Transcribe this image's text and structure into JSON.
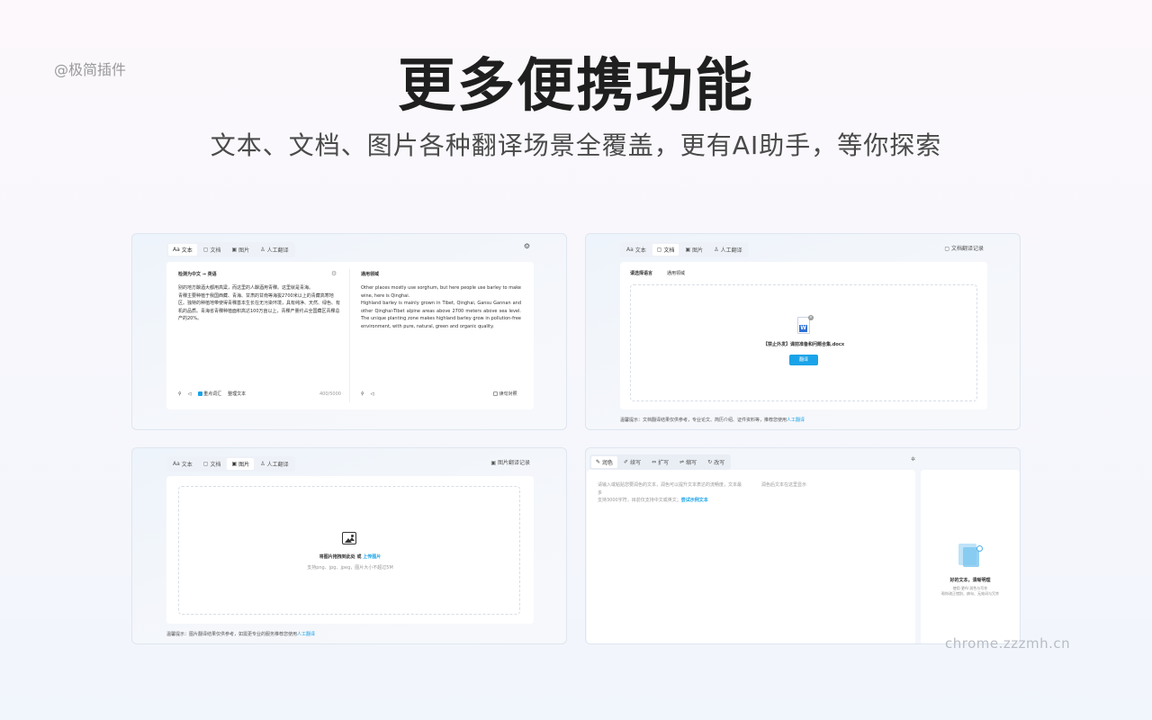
{
  "brand": "@极简插件",
  "hero": {
    "title": "更多便携功能",
    "subtitle": "文本、文档、图片各种翻译场景全覆盖，更有AI助手，等你探索"
  },
  "watermark": "chrome.zzzmh.cn",
  "tabs": {
    "text": "文本",
    "doc": "文档",
    "image": "图片",
    "human": "人工翻译"
  },
  "panel_text": {
    "source_lang": "检测为中文 → 英语",
    "target_domain": "通用领域",
    "source_text_1": "别的地方酿酒大都用高粱，而这里的人酿酒用青稞。这里就是青海。",
    "source_text_2": "青稞主要种植于我国西藏、青海、甘肃的甘南等海拔2700米以上的青藏高寒地区。独特的种植地带使得青稞基本生长在无污染环境，具有纯净、天然、绿色、有机的品质。青海省青稞种植面积高达100万亩以上，青稞产量约占全国藏区青稞总产的20%。",
    "target_text_1": "Other places mostly use sorghum, but here people use barley to make wine, here is Qinghai.",
    "target_text_2": "Highland barley is mainly grown in Tibet, Qinghai, Gansu Gannan and other Qinghai-Tibet alpine areas above 2700 meters above sea level. The unique planting zone makes highland barley grow in pollution-free environment, with pure, natural, green and organic quality.",
    "highlight_label": "重点词汇",
    "organize_label": "整理文本",
    "char_count": "400/5000",
    "read_label": "读句对照"
  },
  "panel_doc": {
    "history": "文档翻译记录",
    "choose_lang": "请选择语言",
    "domain": "通用领域",
    "file_name": "【禁止外发】课前准备和问题合集.docx",
    "translate_button": "翻译",
    "hint": "温馨提示：文档翻译结果仅供参考，专业论文、简历介绍、证件资料等，推荐您使用",
    "hint_link": "人工翻译"
  },
  "panel_image": {
    "history": "图片翻译记录",
    "drop_text": "将图片拖拽到此处 或",
    "upload_link": "上传图片",
    "support_text": "支持png、jpg、jpeg，图片大小不超过5M",
    "hint": "温馨提示：图片翻译结果仅供参考，如需更专业的服务推荐您使用",
    "hint_link": "人工翻译"
  },
  "panel_ai": {
    "tabs": [
      "润色",
      "续写",
      "扩写",
      "缩写",
      "改写"
    ],
    "placeholder_1": "请输入或粘贴您要润色的文本，润色可以提升文本表达的流畅度，文本最多",
    "placeholder_2": "支持3000字符，目前仅支持中文或英文；",
    "try_example": "尝试示例文本",
    "result_placeholder": "润色后文本在这里显示",
    "empty_title": "好的文本，清晰明理",
    "empty_desc_1": "使用 更AI 润色与写作",
    "empty_desc_2": "帮你改正错别、病句、无效词与冗余"
  }
}
